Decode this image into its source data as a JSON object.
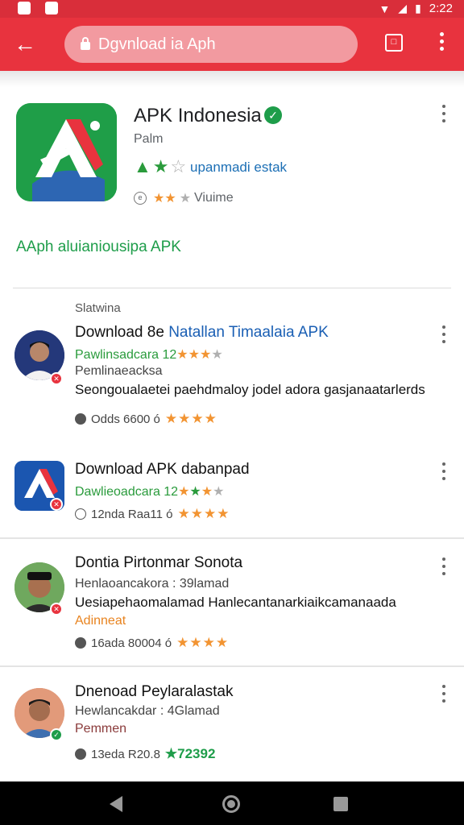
{
  "status_bar": {
    "time": "2:22"
  },
  "browser": {
    "url": "Dgvnload ia Aph"
  },
  "app": {
    "title": "APK Indonesia",
    "subtitle": "Palm",
    "developer_link": "upanmadi estak",
    "meta": "Viuime",
    "tagline": "AAph aluianiousipa APK"
  },
  "list_section_label": "Slatwina",
  "items": [
    {
      "title_part1": "Download 8e ",
      "title_part2": "Natallan Timaalaia APK",
      "line1": "Pawlinsadcara 12",
      "line2": "Pemlinaeacksa",
      "line3": "Seongoualaetei paehdmaloy jodel adora gasjanaatarlerds",
      "stats_text": "Odds 6600 ó",
      "stars": "★★★★"
    },
    {
      "title": "Download APK dabanpad",
      "line1": "Dawlieoadcara 12",
      "stats_text": "12nda Raa11 ó",
      "stars": "★★★★"
    },
    {
      "title": "Dontia Pirtonmar Sonota",
      "line1": "Henlaoancakora : 39lamad",
      "line2": "Uesiapehaomalamad Hanlecantanarkiaikcamanaada",
      "line3": "Adinneat",
      "stats_text": "16ada 80004 ó",
      "stars": "★★★★"
    },
    {
      "title": "Dnenoad Peylaralastak",
      "line1": "Hewlancakdar : 4Glamad",
      "line2": "Pemmen",
      "stats_text": "13eda R20.8",
      "stars": "★72392"
    }
  ]
}
